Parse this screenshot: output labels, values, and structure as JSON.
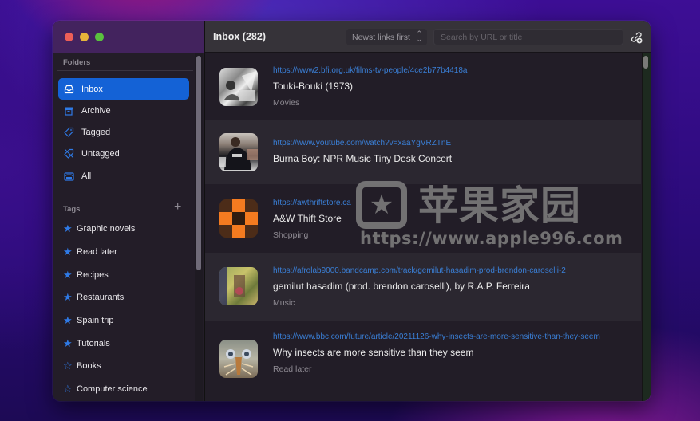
{
  "window": {
    "traffic_lights": [
      "close",
      "minimize",
      "zoom"
    ]
  },
  "sidebar": {
    "folders_label": "Folders",
    "folders": [
      {
        "label": "Inbox",
        "icon": "inbox-icon",
        "active": true
      },
      {
        "label": "Archive",
        "icon": "archive-icon",
        "active": false
      },
      {
        "label": "Tagged",
        "icon": "tag-icon",
        "active": false
      },
      {
        "label": "Untagged",
        "icon": "untagged-icon",
        "active": false
      },
      {
        "label": "All",
        "icon": "all-icon",
        "active": false
      }
    ],
    "tags_label": "Tags",
    "add_tag_symbol": "+",
    "tags": [
      {
        "label": "Graphic novels",
        "starred": true
      },
      {
        "label": "Read later",
        "starred": true
      },
      {
        "label": "Recipes",
        "starred": true
      },
      {
        "label": "Restaurants",
        "starred": true
      },
      {
        "label": "Spain trip",
        "starred": true
      },
      {
        "label": "Tutorials",
        "starred": true
      },
      {
        "label": "Books",
        "starred": false
      },
      {
        "label": "Computer science",
        "starred": false
      }
    ]
  },
  "toolbar": {
    "title": "Inbox (282)",
    "sort_value": "Newst links first",
    "search_placeholder": "Search by URL or title",
    "search_value": "",
    "add_link_icon": "link-add-icon"
  },
  "links": [
    {
      "url": "https://www2.bfi.org.uk/films-tv-people/4ce2b77b4418a",
      "title": "Touki-Bouki (1973)",
      "tag": "Movies",
      "thumb": "bw-film-still"
    },
    {
      "url": "https://www.youtube.com/watch?v=xaaYgVRZTnE",
      "title": "Burna Boy: NPR Music Tiny Desk Concert",
      "tag": "",
      "thumb": "concert-photo"
    },
    {
      "url": "https://awthriftstore.ca",
      "title": "A&W Thift Store",
      "tag": "Shopping",
      "thumb": "orange-checker-logo"
    },
    {
      "url": "https://afrolab9000.bandcamp.com/track/gemilut-hasadim-prod-brendon-caroselli-2",
      "title": "gemilut hasadim (prod. brendon caroselli), by R.A.P. Ferreira",
      "tag": "Music",
      "thumb": "album-art"
    },
    {
      "url": "https://www.bbc.com/future/article/20211126-why-insects-are-more-sensitive-than-they-seem",
      "title": "Why insects are more sensitive than they seem",
      "tag": "Read later",
      "thumb": "insect-photo"
    }
  ],
  "watermark": {
    "cn_text": "苹果家园",
    "url_text": "https://www.apple996.com"
  },
  "colors": {
    "accent": "#1462d6",
    "link": "#3a7fd6",
    "star": "#2f7ae6"
  }
}
